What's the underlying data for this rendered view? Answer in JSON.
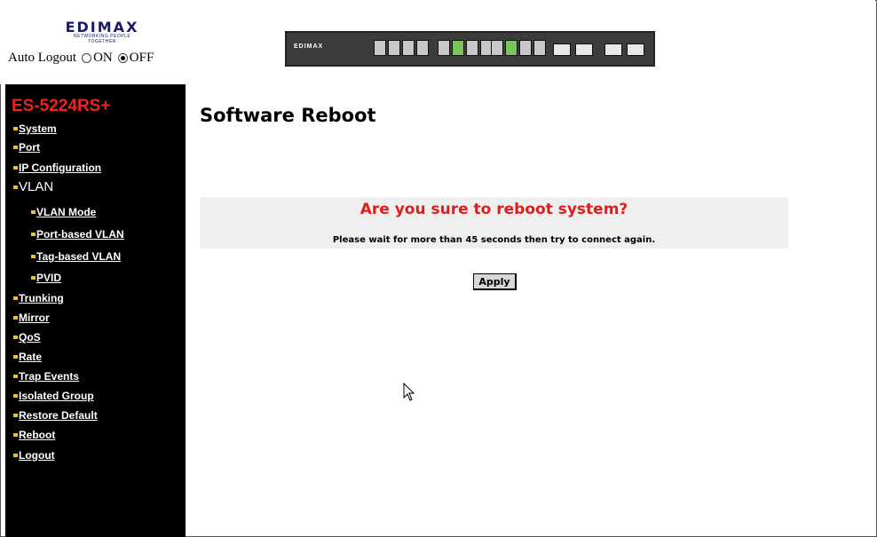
{
  "header": {
    "logo": {
      "brand": "EDIMAX",
      "tagline": "NETWORKING PEOPLE TOGETHER"
    },
    "auto_logout": {
      "label": "Auto Logout",
      "options": [
        "ON",
        "OFF"
      ],
      "selected": "OFF"
    },
    "switch_image": {
      "brand": "EDIMAX"
    }
  },
  "sidebar": {
    "model": "ES-5224RS+",
    "model_color": "#e8261f",
    "bullet_color": "#f0c020",
    "items": [
      {
        "label": "System"
      },
      {
        "label": "Port"
      },
      {
        "label": "IP Configuration"
      },
      {
        "label": "VLAN"
      },
      {
        "label": "VLAN Mode"
      },
      {
        "label": "Port-based VLAN"
      },
      {
        "label": "Tag-based VLAN"
      },
      {
        "label": "PVID"
      },
      {
        "label": "Trunking"
      },
      {
        "label": "Mirror"
      },
      {
        "label": "QoS"
      },
      {
        "label": "Rate"
      },
      {
        "label": "Trap Events"
      },
      {
        "label": "Isolated Group"
      },
      {
        "label": "Restore Default"
      },
      {
        "label": "Reboot"
      },
      {
        "label": "Logout"
      }
    ]
  },
  "main": {
    "title": "Software Reboot",
    "confirm_question": "Are you sure to reboot system?",
    "confirm_note": "Please wait for more than 45 seconds then try to connect again.",
    "apply_label": "Apply",
    "question_color": "#e31b1b"
  }
}
